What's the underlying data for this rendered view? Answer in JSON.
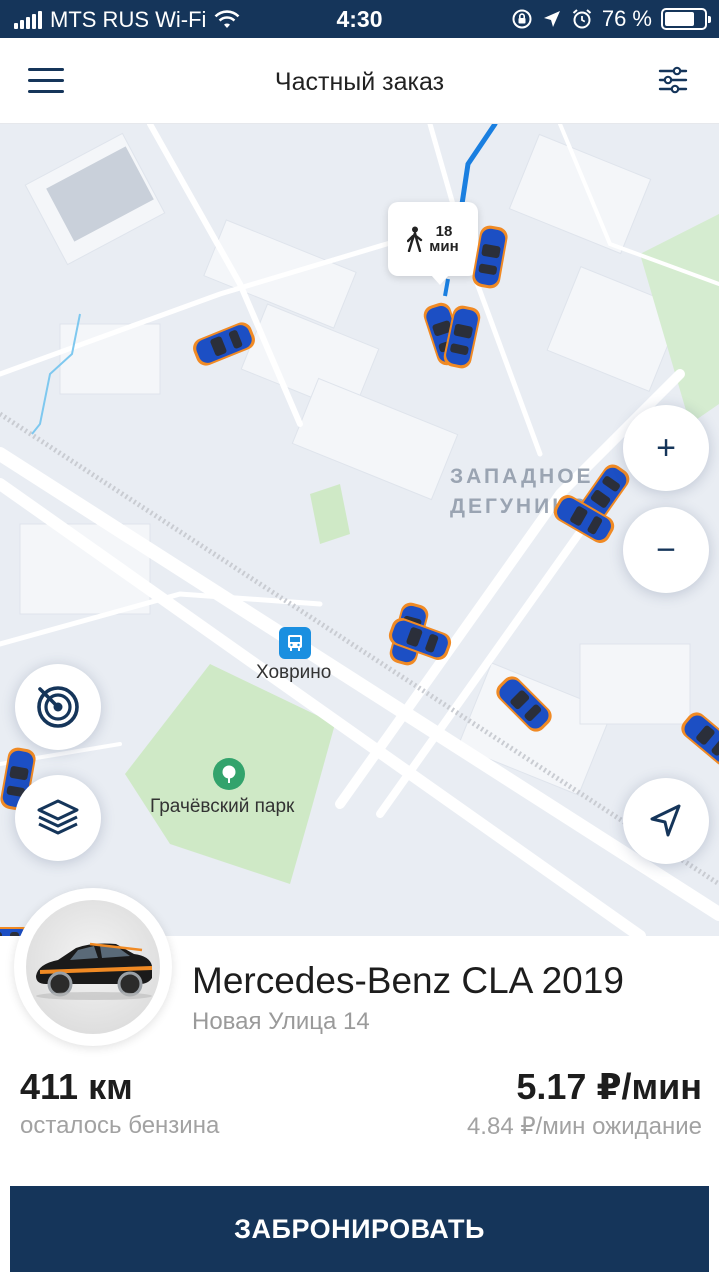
{
  "status_bar": {
    "carrier": "MTS RUS Wi-Fi",
    "time": "4:30",
    "battery_percent": "76 %",
    "battery_level": 0.76,
    "icons": [
      "signal-icon",
      "wifi-icon",
      "lock-rotation-icon",
      "location-arrow-icon",
      "alarm-icon",
      "battery-icon"
    ]
  },
  "header": {
    "title": "Частный заказ",
    "menu_icon": "hamburger-menu-icon",
    "filter_icon": "filter-sliders-icon"
  },
  "map": {
    "walk_badge": {
      "value": "18",
      "unit": "мин",
      "icon": "pedestrian-icon"
    },
    "district": {
      "line1": "ЗАПАДНОЕ",
      "line2": "ДЕГУНИНО"
    },
    "station": {
      "label": "Ховрино",
      "icon": "bus-stop-icon"
    },
    "park": {
      "label": "Грачёвский парк",
      "icon": "park-tree-icon"
    },
    "controls": {
      "zoom_in": "+",
      "zoom_out": "−",
      "radar_icon": "radar-icon",
      "layers_icon": "layers-icon",
      "locate_icon": "navigation-arrow-icon"
    },
    "colors": {
      "car_body": "#1c4fc4",
      "car_stripe": "#f08a24",
      "route": "#1a7fe0",
      "park": "#cfe9c6"
    }
  },
  "car": {
    "model": "Mercedes-Benz CLA 2019",
    "address": "Новая Улица 14",
    "fuel_value": "411 км",
    "fuel_label": "осталось бензина",
    "price_value": "5.17 ₽/мин",
    "price_label": "4.84 ₽/мин ожидание"
  },
  "actions": {
    "book_label": "ЗАБРОНИРОВАТЬ"
  }
}
